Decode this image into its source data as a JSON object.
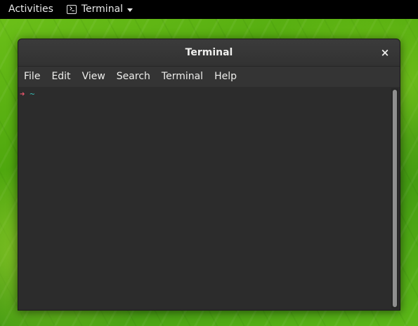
{
  "topbar": {
    "activities_label": "Activities",
    "app_menu_label": "Terminal",
    "app_icon": "terminal-icon",
    "caret_icon": "chevron-down-icon"
  },
  "window": {
    "title": "Terminal",
    "close_label": "×",
    "menu": [
      "File",
      "Edit",
      "View",
      "Search",
      "Terminal",
      "Help"
    ],
    "prompt": {
      "arrow": "➜",
      "cwd": "~"
    }
  },
  "colors": {
    "prompt_arrow": "#e8556b",
    "prompt_cwd": "#36b7b0",
    "terminal_bg": "#2c2c2c",
    "desktop_green": "#4fa80e"
  }
}
